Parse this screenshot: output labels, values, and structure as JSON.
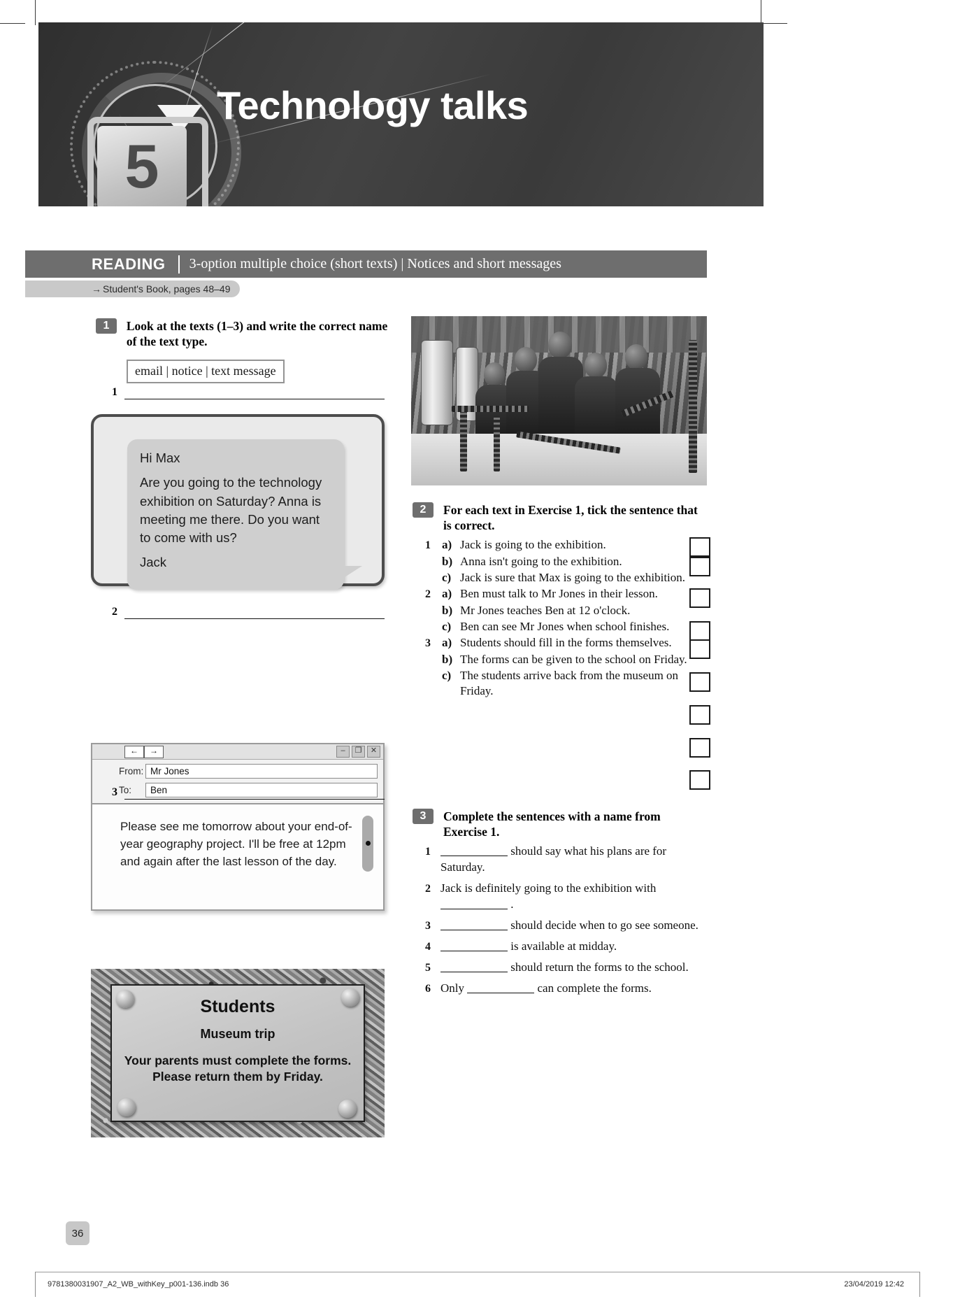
{
  "banner": {
    "unit_number": "5",
    "unit_title": "Technology talks"
  },
  "skill_header": {
    "skill": "READING",
    "description": "3-option multiple choice (short texts) | Notices and short messages",
    "arrow_icon": "→",
    "student_book_ref": "Student's Book, pages 48–49"
  },
  "exercise1": {
    "number": "1",
    "instruction": "Look at the texts (1–3) and write the correct name of the text type.",
    "wordbank": "email | notice | text message",
    "answers": [
      {
        "number": "1"
      },
      {
        "number": "2"
      },
      {
        "number": "3"
      }
    ]
  },
  "text1_message": {
    "greeting": "Hi Max",
    "body": "Are you going to the technology exhibition on Saturday? Anna is meeting me there. Do you want to come with us?",
    "signature": "Jack"
  },
  "text2_email": {
    "back_icon": "←",
    "forward_icon": "→",
    "minimize_icon": "–",
    "restore_icon": "❐",
    "close_icon": "✕",
    "from_label": "From:",
    "from_value": "Mr Jones",
    "to_label": "To:",
    "to_value": "Ben",
    "body": "Please see me tomorrow about your end-of-year geography project. I'll be free at 12pm and again after the last lesson of the day."
  },
  "text3_notice": {
    "title": "Students",
    "subtitle": "Museum trip",
    "body": "Your parents must complete the forms. Please return them by Friday."
  },
  "exercise2": {
    "number": "2",
    "instruction": "For each text in Exercise 1, tick the sentence that is correct.",
    "groups": [
      {
        "number": "1",
        "options": [
          {
            "letter": "a)",
            "text": "Jack is going to the exhibition."
          },
          {
            "letter": "b)",
            "text": "Anna isn't going to the exhibition."
          },
          {
            "letter": "c)",
            "text": "Jack is sure that Max is going to the exhibition."
          }
        ]
      },
      {
        "number": "2",
        "options": [
          {
            "letter": "a)",
            "text": "Ben must talk to Mr Jones in their lesson."
          },
          {
            "letter": "b)",
            "text": "Mr Jones teaches Ben at 12 o'clock."
          },
          {
            "letter": "c)",
            "text": "Ben can see Mr Jones when school finishes."
          }
        ]
      },
      {
        "number": "3",
        "options": [
          {
            "letter": "a)",
            "text": "Students should fill in the forms themselves."
          },
          {
            "letter": "b)",
            "text": "The forms can be given to the school on Friday."
          },
          {
            "letter": "c)",
            "text": "The students arrive back from the museum on Friday."
          }
        ]
      }
    ]
  },
  "exercise3": {
    "number": "3",
    "instruction": "Complete the sentences with a name from Exercise 1.",
    "items": [
      {
        "number": "1",
        "before": "",
        "after": "should say what his plans are for Saturday."
      },
      {
        "number": "2",
        "before": "Jack is definitely going to the exhibition with",
        "after": "."
      },
      {
        "number": "3",
        "before": "",
        "after": "should decide when to go see someone."
      },
      {
        "number": "4",
        "before": "",
        "after": "is available at midday."
      },
      {
        "number": "5",
        "before": "",
        "after": "should return the forms to the school."
      },
      {
        "number": "6",
        "before": "Only",
        "after": "can complete the forms."
      }
    ]
  },
  "page": {
    "number": "36"
  },
  "footer": {
    "left": "9781380031907_A2_WB_withKey_p001-136.indb   36",
    "right": "23/04/2019   12:42"
  }
}
